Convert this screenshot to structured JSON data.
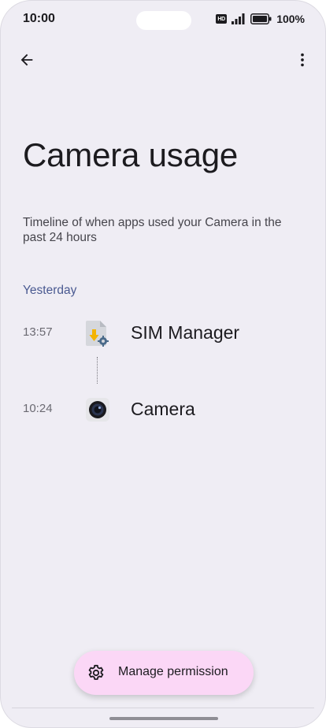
{
  "status_bar": {
    "time": "10:00",
    "network_badge": "HD",
    "battery_percent": "100%",
    "icons": [
      "hd-icon",
      "signal-icon",
      "battery-icon"
    ]
  },
  "toolbar": {
    "back_icon": "arrow-back-icon",
    "more_icon": "more-vert-icon"
  },
  "page": {
    "title": "Camera usage",
    "subtitle": "Timeline of when apps used your Camera in the past 24 hours"
  },
  "timeline": {
    "section_label": "Yesterday",
    "entries": [
      {
        "time": "13:57",
        "app_name": "SIM Manager",
        "icon": "sim-manager-app-icon"
      },
      {
        "time": "10:24",
        "app_name": "Camera",
        "icon": "camera-app-icon"
      }
    ]
  },
  "fab": {
    "label": "Manage permission",
    "icon": "gear-icon"
  },
  "colors": {
    "background": "#efedf4",
    "accent_label": "#4a5a91",
    "fab_background": "#fbd7f6",
    "text_primary": "#1c1b1f"
  }
}
